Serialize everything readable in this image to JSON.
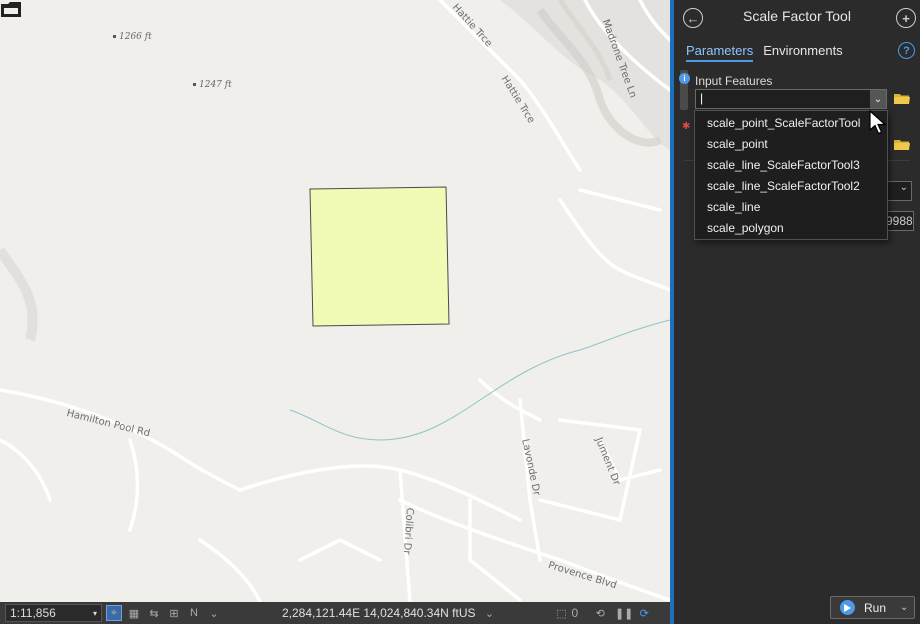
{
  "panel": {
    "title": "Scale Factor Tool",
    "tabs": [
      "Parameters",
      "Environments"
    ],
    "input_label": "Input Features",
    "input_value": "|",
    "hidden_value": "9988",
    "run_label": "Run"
  },
  "dropdown": {
    "items": [
      "scale_point_ScaleFactorTool",
      "scale_point",
      "scale_line_ScaleFactorTool3",
      "scale_line_ScaleFactorTool2",
      "scale_line",
      "scale_polygon"
    ]
  },
  "map": {
    "elevations": [
      "1266 ft",
      "1247 ft"
    ],
    "roads": {
      "hattie_trce_1": "Hattie Trce",
      "hattie_trce_2": "Hattie Trce",
      "madrone": "Madrone Tree Ln",
      "hamilton": "Hamilton Pool Rd",
      "lavonde": "Lavonde Dr",
      "jument": "Jument Dr",
      "colibri": "Colibri Dr",
      "provence": "Provence Blvd"
    },
    "polygon_fill": "#f2fbb5"
  },
  "status": {
    "scale": "1:11,856",
    "coordinates": "2,284,121.44E 14,024,840.34N ftUS",
    "selected_count": "0"
  },
  "colors": {
    "accent": "#1e6fbf",
    "panel_bg": "#2b2b2b"
  }
}
